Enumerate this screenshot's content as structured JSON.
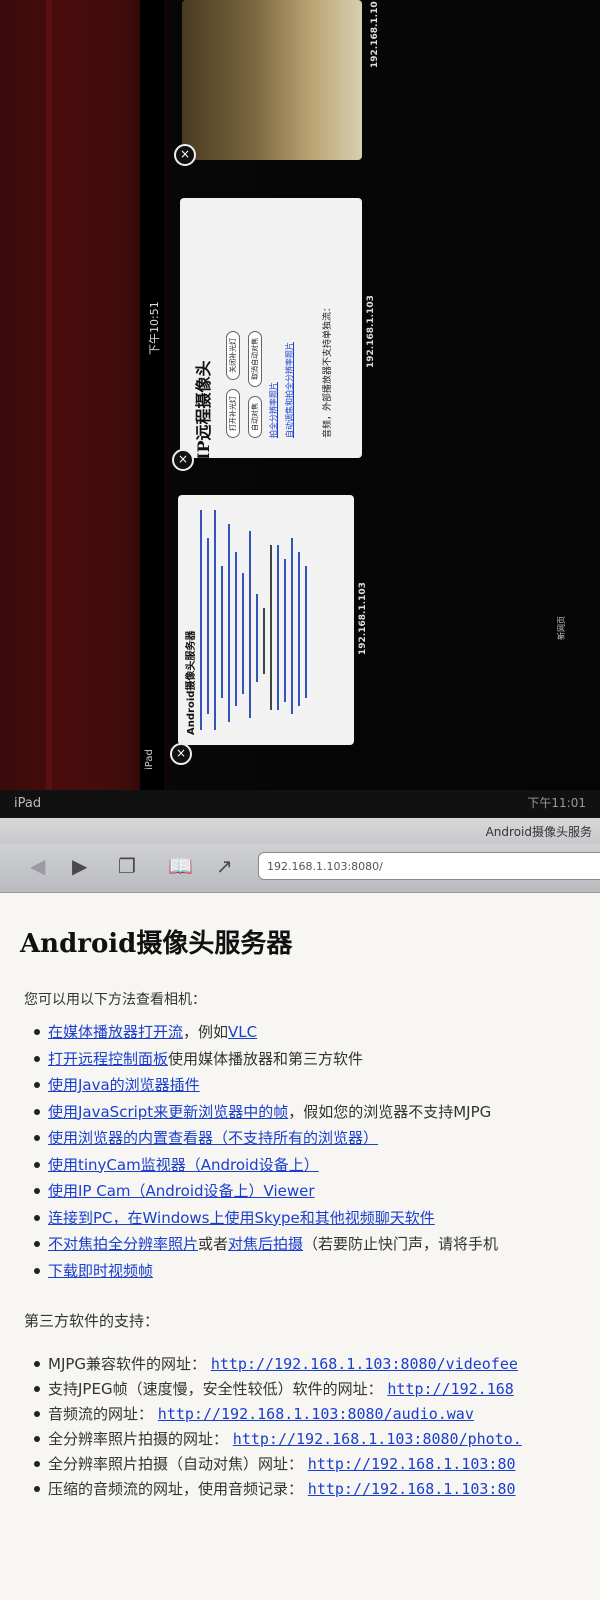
{
  "tab_switcher": {
    "device_label": "iPad",
    "time": "下午10:51",
    "tabs": [
      {
        "ip": "192.168.1.103",
        "title": "Android摄像头服务器"
      },
      {
        "ip": "192.168.1.103",
        "title": "IP远程摄像头",
        "buttons": [
          "打开补光灯",
          "关闭补光灯",
          "自动对焦",
          "取消自动对焦"
        ],
        "links": [
          "拍全分辨率照片",
          "自动调焦和拍全分辨率照片"
        ],
        "audio_text": "音频，外部播放器不支持单独流："
      },
      {
        "ip": "192.168.1.10",
        "title": ""
      }
    ],
    "new_page_label": "新网页"
  },
  "safari": {
    "status_label": "iPad",
    "time": "下午11:01",
    "page_title": "Android摄像头服务",
    "url": "192.168.1.103:8080/",
    "heading": "Android摄像头服务器",
    "intro": "您可以用以下方法查看相机：",
    "methods": [
      {
        "link": "在媒体播放器打开流",
        "rest": "，例如",
        "link2": "VLC",
        "tail": ""
      },
      {
        "link": "打开远程控制面板",
        "rest": "使用媒体播放器和第三方软件",
        "link2": "",
        "tail": ""
      },
      {
        "link": "使用Java的浏览器插件",
        "rest": "",
        "link2": "",
        "tail": ""
      },
      {
        "link": "使用JavaScript来更新浏览器中的帧",
        "rest": "，假如您的浏览器不支持MJPG",
        "link2": "",
        "tail": ""
      },
      {
        "link": "使用浏览器的内置查看器（不支持所有的浏览器）",
        "rest": "",
        "link2": "",
        "tail": ""
      },
      {
        "link": "使用tinyCam监视器（Android设备上）",
        "rest": "",
        "link2": "",
        "tail": ""
      },
      {
        "link": "使用IP Cam（Android设备上）Viewer",
        "rest": "",
        "link2": "",
        "tail": ""
      },
      {
        "link": "连接到PC，在Windows上使用Skype和其他视频聊天软件",
        "rest": "",
        "link2": "",
        "tail": ""
      },
      {
        "link": "不对焦拍全分辨率照片",
        "rest": "或者",
        "link2": "对焦后拍摄",
        "tail": "（若要防止快门声，请将手机"
      },
      {
        "link": "下载即时视频帧",
        "rest": "",
        "link2": "",
        "tail": ""
      }
    ],
    "third_party_heading": "第三方软件的支持：",
    "third_party": [
      {
        "label": "MJPG兼容软件的网址：",
        "url": "http://192.168.1.103:8080/videofee"
      },
      {
        "label": "支持JPEG帧（速度慢，安全性较低）软件的网址：",
        "url": "http://192.168"
      },
      {
        "label": "音频流的网址：",
        "url": "http://192.168.1.103:8080/audio.wav"
      },
      {
        "label": "全分辨率照片拍摄的网址：",
        "url": "http://192.168.1.103:8080/photo."
      },
      {
        "label": "全分辨率照片拍摄（自动对焦）网址：",
        "url": "http://192.168.1.103:80"
      },
      {
        "label": "压缩的音频流的网址，使用音频记录：",
        "url": "http://192.168.1.103:80"
      }
    ]
  }
}
